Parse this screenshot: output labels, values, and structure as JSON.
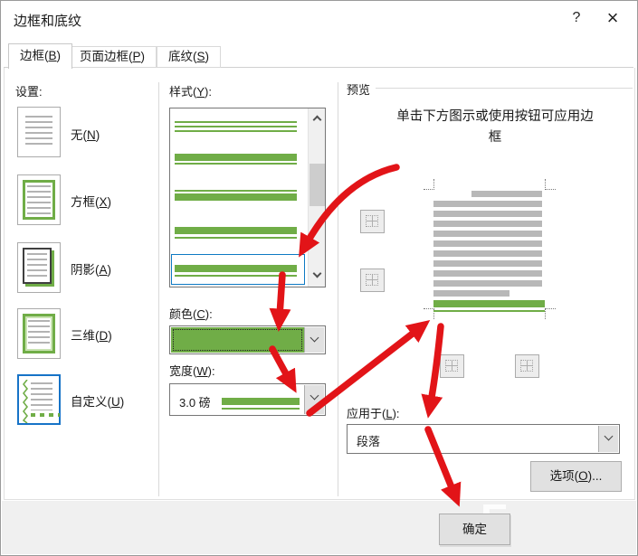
{
  "window": {
    "title": "边框和底纹",
    "help_glyph": "?",
    "close_glyph": "×"
  },
  "tabs": [
    {
      "label": "边框(B)",
      "active": true
    },
    {
      "label": "页面边框(P)",
      "active": false
    },
    {
      "label": "底纹(S)",
      "active": false
    }
  ],
  "settings": {
    "label": "设置:",
    "items": [
      {
        "label": "无(N)",
        "type": "none",
        "selected": false
      },
      {
        "label": "方框(X)",
        "type": "box",
        "selected": false
      },
      {
        "label": "阴影(A)",
        "type": "shadow",
        "selected": false
      },
      {
        "label": "三维(D)",
        "type": "3d",
        "selected": false
      },
      {
        "label": "自定义(U)",
        "type": "custom",
        "selected": true
      }
    ]
  },
  "style_list": {
    "label": "样式(Y):",
    "options": [
      {
        "pattern": "triple",
        "selected": false
      },
      {
        "pattern": "thick-thin",
        "selected": false
      },
      {
        "pattern": "thin-thick",
        "selected": false
      },
      {
        "pattern": "thick-gap-thin",
        "selected": false
      },
      {
        "pattern": "thick-gap-thin",
        "selected": true
      }
    ]
  },
  "color": {
    "label": "颜色(C):",
    "value_hex": "#70ad47"
  },
  "width": {
    "label": "宽度(W):",
    "value": "3.0 磅"
  },
  "preview": {
    "label": "预览",
    "instruction": "单击下方图示或使用按钮可应用边框",
    "applied_border": "bottom",
    "border_color_hex": "#70ad47"
  },
  "apply_to": {
    "label": "应用于(L):",
    "value": "段落"
  },
  "buttons": {
    "options": "选项(O)...",
    "ok": "确定"
  },
  "colors": {
    "accent_green": "#70ad47",
    "arrow_red": "#e21418",
    "selection_blue": "#0e7ac4"
  }
}
